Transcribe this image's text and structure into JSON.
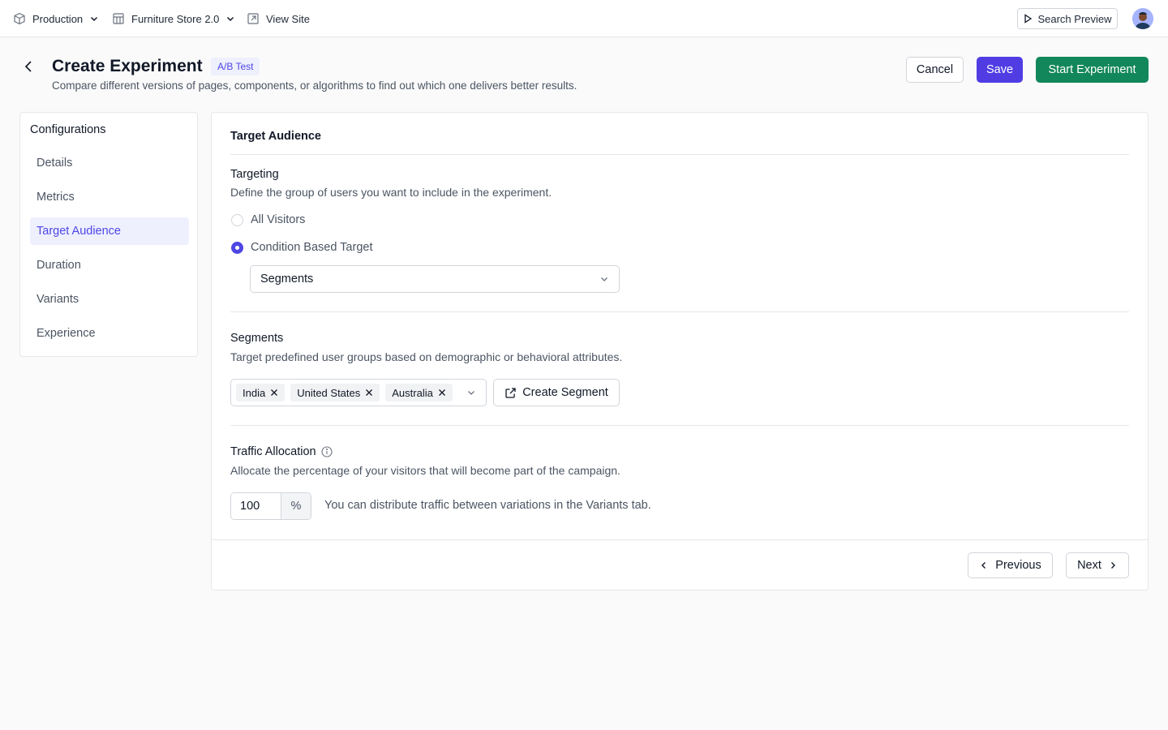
{
  "topbar": {
    "environment": "Production",
    "store": "Furniture Store 2.0",
    "view_site": "View Site",
    "search_preview": "Search Preview"
  },
  "header": {
    "title": "Create Experiment",
    "badge": "A/B Test",
    "subtitle": "Compare different versions of pages, components, or algorithms to find out which one delivers better results.",
    "cancel": "Cancel",
    "save": "Save",
    "start": "Start Experiment"
  },
  "sidebar": {
    "title": "Configurations",
    "items": [
      {
        "label": "Details"
      },
      {
        "label": "Metrics"
      },
      {
        "label": "Target Audience",
        "active": true
      },
      {
        "label": "Duration"
      },
      {
        "label": "Variants"
      },
      {
        "label": "Experience"
      }
    ]
  },
  "panel": {
    "section_title": "Target Audience",
    "targeting": {
      "label": "Targeting",
      "description": "Define the group of users you want to include in the experiment.",
      "options": [
        {
          "label": "All Visitors",
          "checked": false
        },
        {
          "label": "Condition Based Target",
          "checked": true
        }
      ],
      "select_value": "Segments"
    },
    "segments": {
      "label": "Segments",
      "description": "Target predefined user groups based on demographic or behavioral attributes.",
      "tags": [
        "India",
        "United States",
        "Australia"
      ],
      "create_button": "Create Segment"
    },
    "traffic": {
      "label": "Traffic Allocation",
      "description": "Allocate the percentage of your visitors that will become part of the campaign.",
      "value": "100",
      "suffix": "%",
      "note": "You can distribute traffic between variations in the Variants tab."
    },
    "footer": {
      "previous": "Previous",
      "next": "Next"
    }
  },
  "colors": {
    "primary": "#4f3de3",
    "success": "#12875b",
    "active_bg": "#eef0fe"
  }
}
